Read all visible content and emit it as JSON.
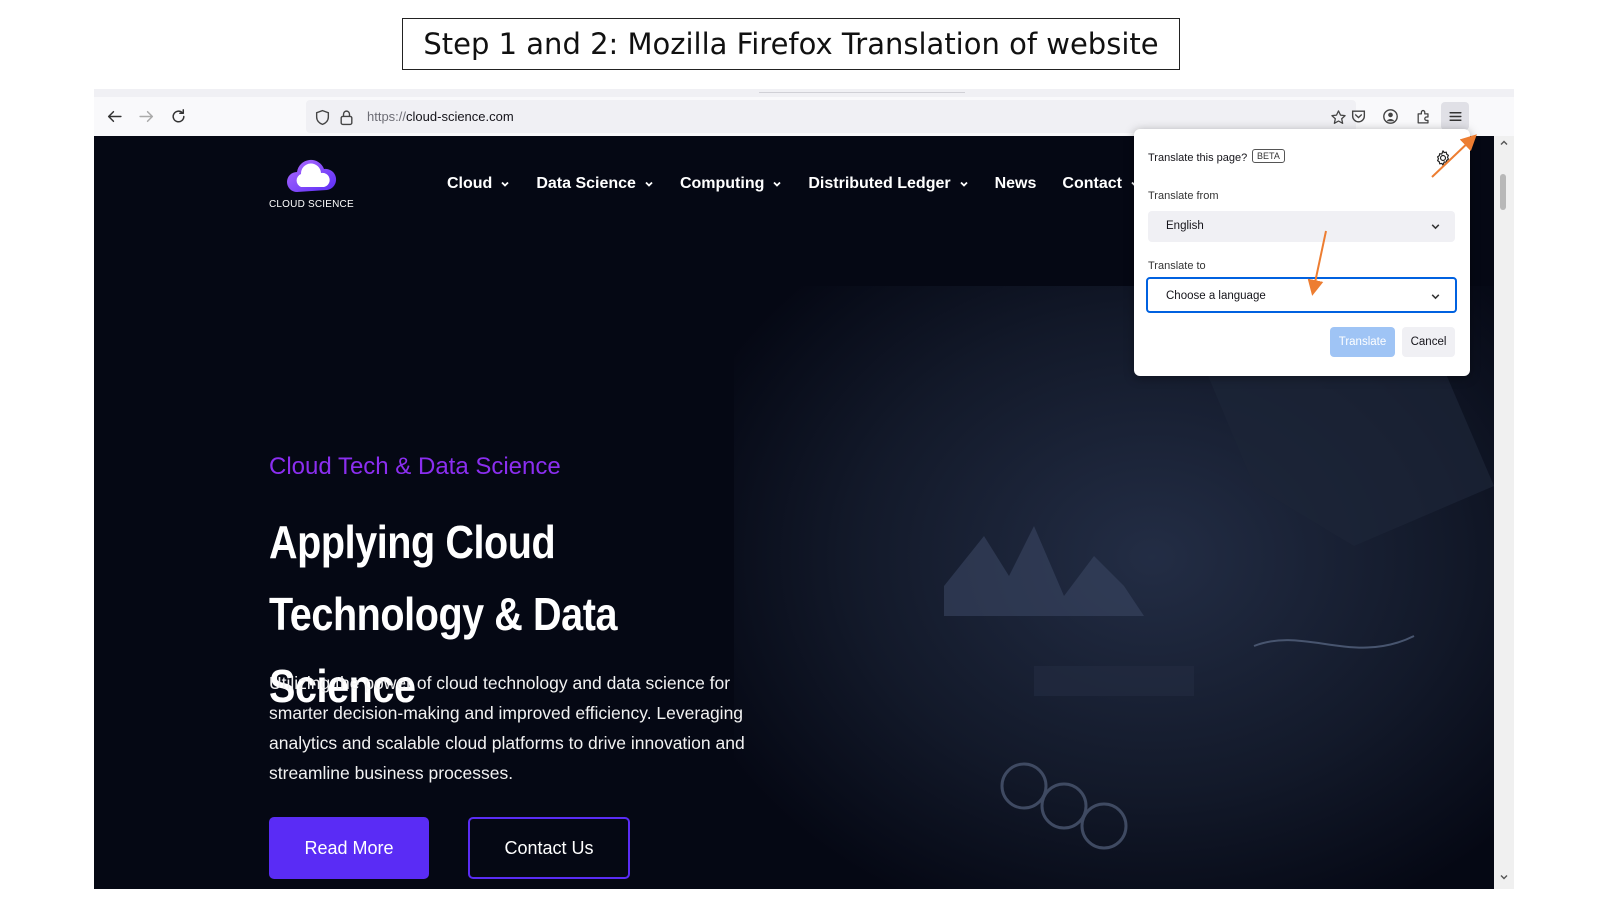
{
  "caption": "Step 1 and 2: Mozilla Firefox Translation of website",
  "browser": {
    "url_protocol": "https://",
    "url_host": "cloud-science.com",
    "icons": [
      "back-icon",
      "forward-icon",
      "reload-icon",
      "shield-icon",
      "lock-icon",
      "bookmark-star-icon",
      "pocket-icon",
      "account-icon",
      "extensions-icon",
      "hamburger-menu-icon"
    ]
  },
  "site": {
    "logo_text": "CLOUD SCIENCE",
    "nav": [
      {
        "label": "Cloud",
        "dropdown": true
      },
      {
        "label": "Data Science",
        "dropdown": true
      },
      {
        "label": "Computing",
        "dropdown": true
      },
      {
        "label": "Distributed Ledger",
        "dropdown": true
      },
      {
        "label": "News",
        "dropdown": false
      },
      {
        "label": "Contact",
        "dropdown": true
      }
    ],
    "kicker": "Cloud Tech & Data Science",
    "headline": "Applying Cloud Technology & Data Science",
    "body": "Utilizing the power of cloud technology and data science for smarter decision-making and improved efficiency. Leveraging analytics and scalable cloud platforms to drive innovation and streamline business processes.",
    "btn_read_more": "Read More",
    "btn_contact": "Contact Us",
    "colors": {
      "accent": "#5a2cf5",
      "kicker": "#8b2ef0",
      "background": "#050814"
    }
  },
  "translate_panel": {
    "title": "Translate this page?",
    "badge": "BETA",
    "from_label": "Translate from",
    "from_value": "English",
    "to_label": "Translate to",
    "to_value": "Choose a language",
    "translate_button": "Translate",
    "cancel_button": "Cancel"
  },
  "annotations": {
    "arrow_color": "#ed7d31"
  }
}
